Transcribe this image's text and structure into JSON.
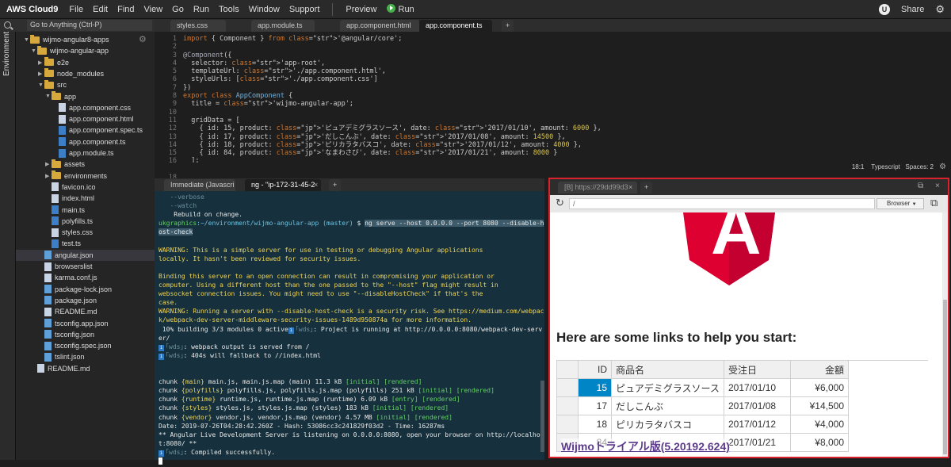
{
  "menubar": {
    "brand": "AWS Cloud9",
    "items": [
      "File",
      "Edit",
      "Find",
      "View",
      "Go",
      "Run",
      "Tools",
      "Window",
      "Support"
    ],
    "preview": "Preview",
    "run": "Run",
    "avatar": "U",
    "share": "Share"
  },
  "sidebar": {
    "strip_label": "Environment",
    "goto_placeholder": "Go to Anything (Ctrl-P)",
    "tree": [
      {
        "label": "wijmo-angular8-apps",
        "kind": "folder",
        "depth": 0,
        "open": true
      },
      {
        "label": "wijmo-angular-app",
        "kind": "folder",
        "depth": 1,
        "open": true
      },
      {
        "label": "e2e",
        "kind": "folder",
        "depth": 2,
        "open": false
      },
      {
        "label": "node_modules",
        "kind": "folder",
        "depth": 2,
        "open": false
      },
      {
        "label": "src",
        "kind": "folder",
        "depth": 2,
        "open": true
      },
      {
        "label": "app",
        "kind": "folder",
        "depth": 3,
        "open": true
      },
      {
        "label": "app.component.css",
        "kind": "file",
        "depth": 4
      },
      {
        "label": "app.component.html",
        "kind": "file",
        "depth": 4
      },
      {
        "label": "app.component.spec.ts",
        "kind": "file",
        "depth": 4
      },
      {
        "label": "app.component.ts",
        "kind": "file",
        "depth": 4
      },
      {
        "label": "app.module.ts",
        "kind": "file",
        "depth": 4
      },
      {
        "label": "assets",
        "kind": "folder",
        "depth": 3,
        "open": false
      },
      {
        "label": "environments",
        "kind": "folder",
        "depth": 3,
        "open": false
      },
      {
        "label": "favicon.ico",
        "kind": "file",
        "depth": 3
      },
      {
        "label": "index.html",
        "kind": "file",
        "depth": 3
      },
      {
        "label": "main.ts",
        "kind": "file",
        "depth": 3
      },
      {
        "label": "polyfills.ts",
        "kind": "file",
        "depth": 3
      },
      {
        "label": "styles.css",
        "kind": "file",
        "depth": 3
      },
      {
        "label": "test.ts",
        "kind": "file",
        "depth": 3
      },
      {
        "label": "angular.json",
        "kind": "file",
        "depth": 2
      },
      {
        "label": "browserslist",
        "kind": "file",
        "depth": 2
      },
      {
        "label": "karma.conf.js",
        "kind": "file",
        "depth": 2
      },
      {
        "label": "package-lock.json",
        "kind": "file",
        "depth": 2
      },
      {
        "label": "package.json",
        "kind": "file",
        "depth": 2
      },
      {
        "label": "README.md",
        "kind": "file",
        "depth": 2
      },
      {
        "label": "tsconfig.app.json",
        "kind": "file",
        "depth": 2
      },
      {
        "label": "tsconfig.json",
        "kind": "file",
        "depth": 2
      },
      {
        "label": "tsconfig.spec.json",
        "kind": "file",
        "depth": 2
      },
      {
        "label": "tslint.json",
        "kind": "file",
        "depth": 2
      },
      {
        "label": "README.md",
        "kind": "file",
        "depth": 1
      }
    ]
  },
  "editor": {
    "tabs": [
      "styles.css",
      "app.module.ts",
      "app.component.html",
      "app.component.ts"
    ],
    "active_tab": "app.component.ts",
    "code_lines": [
      "import { Component } from '@angular/core';",
      "",
      "@Component({",
      "  selector: 'app-root',",
      "  templateUrl: './app.component.html',",
      "  styleUrls: ['./app.component.css']",
      "})",
      "export class AppComponent {",
      "  title = 'wijmo-angular-app';",
      "",
      "  gridData = [",
      "    { id: 15, product: 'ピュアデミグラスソース', date: '2017/01/10', amount: 6000 },",
      "    { id: 17, product: 'だしこんぶ', date: '2017/01/08', amount: 14500 },",
      "    { id: 18, product: 'ピリカラタバスコ', date: '2017/01/12', amount: 4000 },",
      "    { id: 84, product: 'なまわさび', date: '2017/01/21', amount: 8000 }",
      "  ];",
      "}",
      ""
    ],
    "cursor_pos": "18:1",
    "language": "Typescript",
    "spaces": "Spaces: 2"
  },
  "terminal": {
    "tabs": [
      "Immediate (Javascri",
      "ng - \"ip-172-31-45-2"
    ],
    "lines": [
      {
        "t": "   --verbose",
        "c": "tdim"
      },
      {
        "t": "   --watch",
        "c": "tdim"
      },
      {
        "t": "    Rebuild on change.",
        "c": ""
      },
      {
        "t": "ukgraphics:~/environment/wijmo-angular-app (master) $ ng serve --host 0.0.0.0 --port 8080 --disable-h",
        "c": "prompt"
      },
      {
        "t": "ost-check",
        "c": "hl"
      },
      {
        "t": "",
        "c": ""
      },
      {
        "t": "WARNING: This is a simple server for use in testing or debugging Angular applications",
        "c": "tyel"
      },
      {
        "t": "locally. It hasn't been reviewed for security issues.",
        "c": "tyel"
      },
      {
        "t": "",
        "c": ""
      },
      {
        "t": "Binding this server to an open connection can result in compromising your application or",
        "c": "tyel"
      },
      {
        "t": "computer. Using a different host than the one passed to the \"--host\" flag might result in",
        "c": "tyel"
      },
      {
        "t": "websocket connection issues. You might need to use \"--disableHostCheck\" if that's the",
        "c": "tyel"
      },
      {
        "t": "case.",
        "c": "tyel"
      },
      {
        "t": "WARNING: Running a server with --disable-host-check is a security risk. See https://medium.com/webpac",
        "c": "tyel"
      },
      {
        "t": "k/webpack-dev-server-middleware-security-issues-1489d950874a for more information.",
        "c": "tyel"
      },
      {
        "t": " 10% building 3/3 modules 0 active",
        "c": "wds",
        "after": ": Project is running at http://0.0.0.0:8080/webpack-dev-serv"
      },
      {
        "t": "er/",
        "c": ""
      },
      {
        "t": "",
        "c": "wds",
        "after": ": webpack output is served from /"
      },
      {
        "t": "",
        "c": "wds",
        "after": ": 404s will fallback to //index.html"
      },
      {
        "t": "",
        "c": ""
      },
      {
        "t": "",
        "c": ""
      },
      {
        "t": "chunk {main} main.js, main.js.map (main) 11.3 kB [initial] [rendered]",
        "c": "chunk"
      },
      {
        "t": "chunk {polyfills} polyfills.js, polyfills.js.map (polyfills) 251 kB [initial] [rendered]",
        "c": "chunk"
      },
      {
        "t": "chunk {runtime} runtime.js, runtime.js.map (runtime) 6.09 kB [entry] [rendered]",
        "c": "chunk"
      },
      {
        "t": "chunk {styles} styles.js, styles.js.map (styles) 183 kB [initial] [rendered]",
        "c": "chunk"
      },
      {
        "t": "chunk {vendor} vendor.js, vendor.js.map (vendor) 4.57 MB [initial] [rendered]",
        "c": "chunk"
      },
      {
        "t": "Date: 2019-07-26T04:28:42.260Z - Hash: 53086cc3c241829f03d2 - Time: 16287ms",
        "c": ""
      },
      {
        "t": "** Angular Live Development Server is listening on 0.0.0.0:8080, open your browser on http://localhos",
        "c": ""
      },
      {
        "t": "t:8080/ **",
        "c": ""
      },
      {
        "t": "",
        "c": "wds",
        "after": ": Compiled successfully."
      },
      {
        "t": "",
        "c": "caret"
      }
    ]
  },
  "browser": {
    "tab_label": "[B] https://29dd99d3",
    "url": "/",
    "browser_label": "Browser",
    "heading": "Here are some links to help you start:",
    "grid": {
      "headers": [
        "ID",
        "商品名",
        "受注日",
        "金額"
      ],
      "rows": [
        [
          "15",
          "ピュアデミグラスソース",
          "2017/01/10",
          "¥6,000"
        ],
        [
          "17",
          "だしこんぶ",
          "2017/01/08",
          "¥14,500"
        ],
        [
          "18",
          "ピリカラタバスコ",
          "2017/01/12",
          "¥4,000"
        ],
        [
          "84",
          "",
          "2017/01/21",
          "¥8,000"
        ]
      ]
    },
    "watermark": "Wijmoトライアル版(5.20192.624)",
    "angular_logo_letter": "A"
  },
  "colors": {
    "highlight_border": "#d9222b",
    "terminal_bg": "#16313d",
    "angular_red": "#dd0031",
    "grid_select": "#0085c7"
  }
}
